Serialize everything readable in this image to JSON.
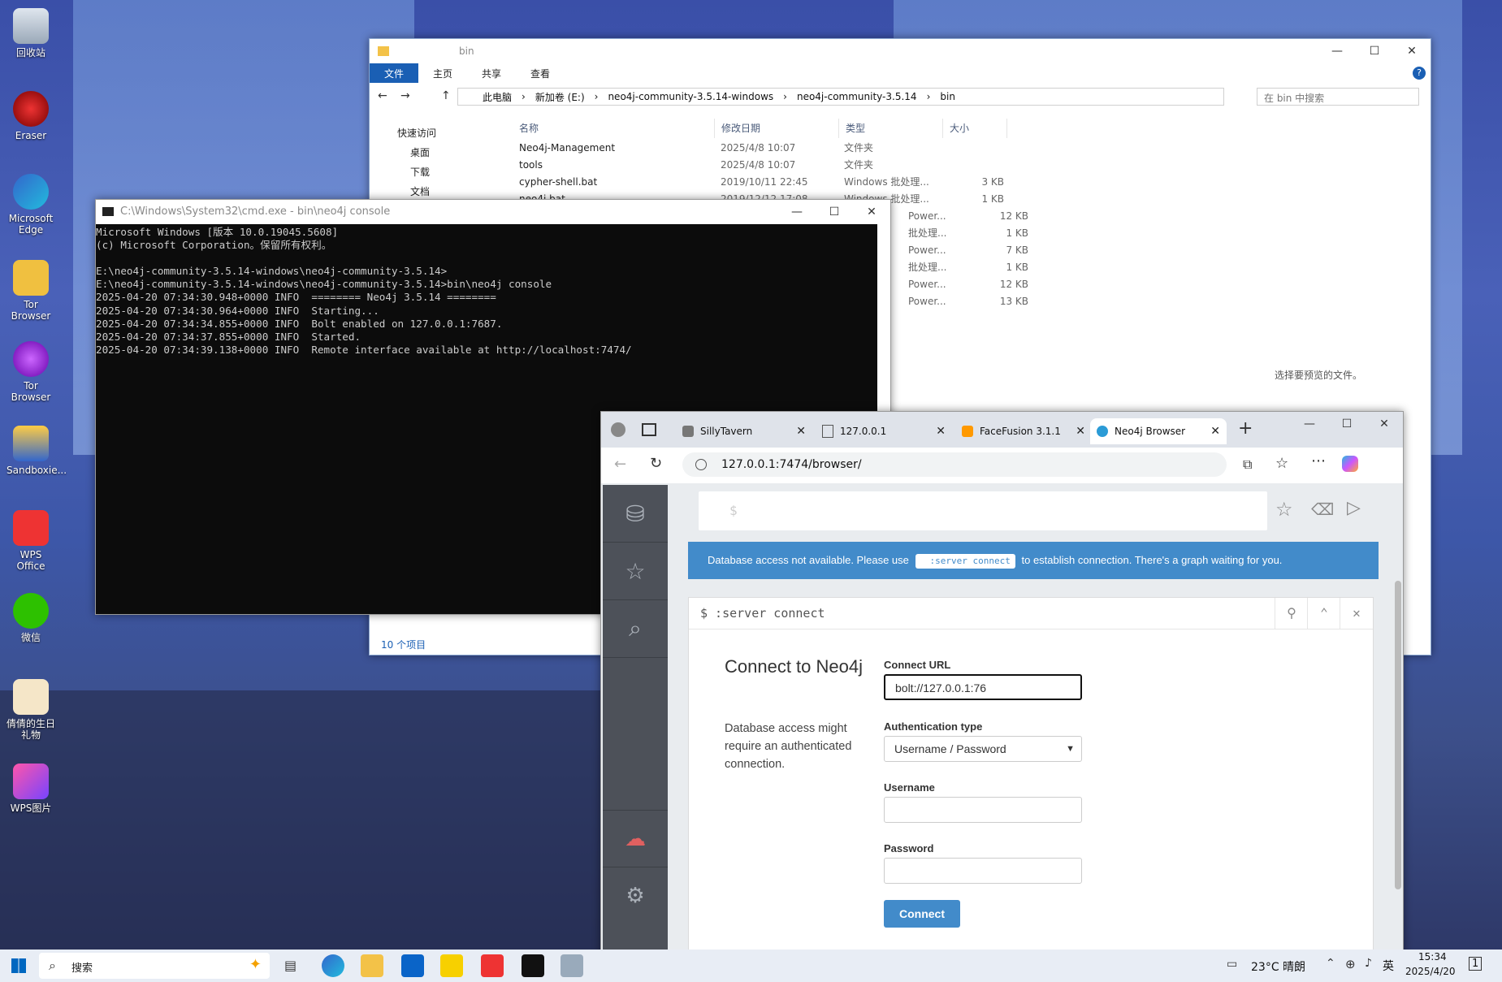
{
  "desktop": {
    "icons": [
      {
        "label": "回收站",
        "name": "recycle-bin-icon"
      },
      {
        "label": "Eraser",
        "name": "eraser-icon"
      },
      {
        "label": "Microsoft Edge",
        "name": "edge-icon"
      },
      {
        "label": "Tor Browser",
        "name": "tor-browser-icon"
      },
      {
        "label": "Tor Browser",
        "name": "tor-browser-icon-2"
      },
      {
        "label": "Sandboxie...",
        "name": "sandboxie-icon"
      },
      {
        "label": "WPS Office",
        "name": "wps-office-icon"
      },
      {
        "label": "微信",
        "name": "wechat-icon"
      },
      {
        "label": "倩倩的生日礼物",
        "name": "gift-folder-icon"
      },
      {
        "label": "WPS图片",
        "name": "wps-pictures-icon"
      }
    ]
  },
  "explorer": {
    "title": "bin",
    "ribbon_tabs": [
      "文件",
      "主页",
      "共享",
      "查看"
    ],
    "breadcrumb": [
      "此电脑",
      "新加卷 (E:)",
      "neo4j-community-3.5.14-windows",
      "neo4j-community-3.5.14",
      "bin"
    ],
    "search_placeholder": "在 bin 中搜索",
    "nav": [
      "快速访问",
      "桌面",
      "下载",
      "文档"
    ],
    "columns": [
      "名称",
      "修改日期",
      "类型",
      "大小"
    ],
    "files": [
      {
        "name": "Neo4j-Management",
        "date": "2025/4/8 10:07",
        "type": "文件夹",
        "size": ""
      },
      {
        "name": "tools",
        "date": "2025/4/8 10:07",
        "type": "文件夹",
        "size": ""
      },
      {
        "name": "cypher-shell.bat",
        "date": "2019/10/11 22:45",
        "type": "Windows 批处理...",
        "size": "3 KB"
      },
      {
        "name": "neo4j.bat",
        "date": "2019/12/12 17:08",
        "type": "Windows 批处理...",
        "size": "1 KB"
      }
    ],
    "extra_rows": [
      {
        "type": "Power...",
        "size": "12 KB"
      },
      {
        "type": "批处理...",
        "size": "1 KB"
      },
      {
        "type": "Power...",
        "size": "7 KB"
      },
      {
        "type": "批处理...",
        "size": "1 KB"
      },
      {
        "type": "Power...",
        "size": "12 KB"
      },
      {
        "type": "Power...",
        "size": "13 KB"
      }
    ],
    "preview_text": "选择要预览的文件。",
    "status": "10 个项目"
  },
  "cmd": {
    "title": "C:\\Windows\\System32\\cmd.exe - bin\\neo4j  console",
    "lines": [
      "Microsoft Windows [版本 10.0.19045.5608]",
      "(c) Microsoft Corporation。保留所有权利。",
      "",
      "E:\\neo4j-community-3.5.14-windows\\neo4j-community-3.5.14>",
      "E:\\neo4j-community-3.5.14-windows\\neo4j-community-3.5.14>bin\\neo4j console",
      "2025-04-20 07:34:30.948+0000 INFO  ======== Neo4j 3.5.14 ========",
      "2025-04-20 07:34:30.964+0000 INFO  Starting...",
      "2025-04-20 07:34:34.855+0000 INFO  Bolt enabled on 127.0.0.1:7687.",
      "2025-04-20 07:34:37.855+0000 INFO  Started.",
      "2025-04-20 07:34:39.138+0000 INFO  Remote interface available at http://localhost:7474/"
    ]
  },
  "browser": {
    "tabs": [
      {
        "label": "SillyTavern"
      },
      {
        "label": "127.0.0.1"
      },
      {
        "label": "FaceFusion 3.1.1"
      },
      {
        "label": "Neo4j Browser"
      }
    ],
    "url": "127.0.0.1:7474/browser/",
    "neo4j": {
      "editor_prompt": "$",
      "banner_before": "Database access not available. Please use",
      "banner_code": ":server connect",
      "banner_after": "to establish connection. There's a graph waiting for you.",
      "frame_command": "$ :server connect",
      "connect_title": "Connect to Neo4j",
      "connect_desc": "Database access might require an authenticated connection.",
      "connect_url_label": "Connect URL",
      "connect_url_value": "bolt://127.0.0.1:76",
      "auth_type_label": "Authentication type",
      "auth_type_value": "Username / Password",
      "username_label": "Username",
      "password_label": "Password",
      "connect_button": "Connect"
    }
  },
  "taskbar": {
    "search_placeholder": "搜索",
    "weather": "23°C  晴朗",
    "ime": "英",
    "time": "15:34",
    "date": "2025/4/20",
    "notifications": "1"
  }
}
